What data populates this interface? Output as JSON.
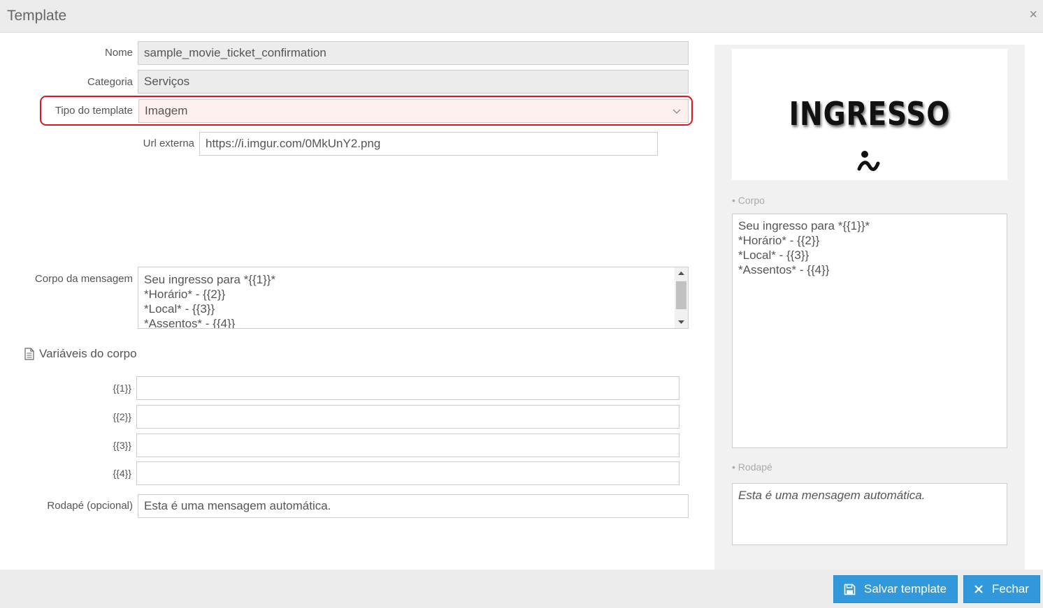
{
  "header": {
    "title": "Template",
    "close_glyph": "×",
    "close_icon": "close-icon"
  },
  "form": {
    "nome": {
      "label": "Nome",
      "value": "sample_movie_ticket_confirmation"
    },
    "categoria": {
      "label": "Categoria",
      "value": "Serviços"
    },
    "tipo": {
      "label": "Tipo do template",
      "value": "Imagem",
      "highlight_color": "#e0141e"
    },
    "url": {
      "label": "Url externa",
      "value": "https://i.imgur.com/0MkUnY2.png"
    },
    "corpo": {
      "label": "Corpo da mensagem",
      "lines": [
        "Seu ingresso para *{{1}}*",
        "*Horário* - {{2}}",
        "*Local* - {{3}}",
        "*Assentos* - {{4}}"
      ]
    },
    "variables": {
      "title": "Variáveis do corpo",
      "items": [
        {
          "label": "{{1}}",
          "value": ""
        },
        {
          "label": "{{2}}",
          "value": ""
        },
        {
          "label": "{{3}}",
          "value": ""
        },
        {
          "label": "{{4}}",
          "value": ""
        }
      ]
    },
    "rodape": {
      "label": "Rodapé (opcional)",
      "value": "Esta é uma mensagem automática."
    }
  },
  "preview": {
    "image_text": "INGRESSO",
    "corpo_label": "• Corpo",
    "corpo_lines": [
      "Seu ingresso para *{{1}}*",
      "*Horário* - {{2}}",
      "*Local* - {{3}}",
      "*Assentos* - {{4}}"
    ],
    "rodape_label": "• Rodapé",
    "rodape_text": "Esta é uma mensagem automática."
  },
  "footer": {
    "save_label": "Salvar template",
    "close_label": "Fechar",
    "accent": "#3199db"
  }
}
